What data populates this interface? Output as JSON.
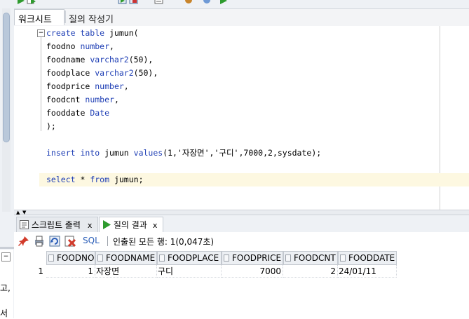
{
  "worksheet_tabs": {
    "worksheet_label": "워크시트",
    "query_builder_label": "질의 작성기"
  },
  "editor": {
    "lines": [
      {
        "plain": "",
        "kw": "create table",
        "rest": " jumun("
      },
      {
        "plain": "foodno ",
        "kw": "number",
        "rest": ","
      },
      {
        "plain": "foodname ",
        "kw": "varchar2",
        "rest": "(50),"
      },
      {
        "plain": "foodplace ",
        "kw": "varchar2",
        "rest": "(50),"
      },
      {
        "plain": "foodprice ",
        "kw": "number",
        "rest": ","
      },
      {
        "plain": "foodcnt ",
        "kw": "number",
        "rest": ","
      },
      {
        "plain": "fooddate ",
        "kw": "Date",
        "rest": ""
      },
      {
        "plain": ");",
        "kw": "",
        "rest": ""
      }
    ],
    "insert_line": {
      "kw1": "insert into",
      "t1": " jumun ",
      "kw2": "values",
      "rest": "(1,'자장면','구디',7000,2,sysdate);"
    },
    "select_line": {
      "kw1": "select",
      "t1": " * ",
      "kw2": "from",
      "rest": " jumun;"
    }
  },
  "result_tabs": {
    "script_output_label": "스크립트 출력",
    "query_result_label": "질의 결과",
    "close_glyph": "x"
  },
  "result_toolbar": {
    "sql_label": "SQL",
    "fetch_message": "인출된 모든 행: 1(0,047초)"
  },
  "grid": {
    "columns": [
      "FOODNO",
      "FOODNAME",
      "FOODPLACE",
      "FOODPRICE",
      "FOODCNT",
      "FOODDATE"
    ],
    "rows": [
      {
        "rownum": "1",
        "cells": [
          "1",
          "자장면",
          "구디",
          "7000",
          "2",
          "24/01/11"
        ]
      }
    ]
  },
  "left_panel": {
    "minus_glyph": "−",
    "fragments": [
      "고,",
      "서"
    ]
  },
  "icons": {
    "toolbar": [
      "run-statement-icon",
      "run-script-icon",
      "commit-icon",
      "rollback-icon",
      "autotrace-icon",
      "explain-plan-icon",
      "clear-icon",
      "history-icon"
    ],
    "result_toolbar": [
      "pin-icon",
      "print-icon",
      "refresh-icon",
      "delete-icon"
    ],
    "colors": {
      "keyword": "#1f3fb5",
      "link": "#2b5eb8",
      "run_green": "#2e9b2e"
    }
  }
}
